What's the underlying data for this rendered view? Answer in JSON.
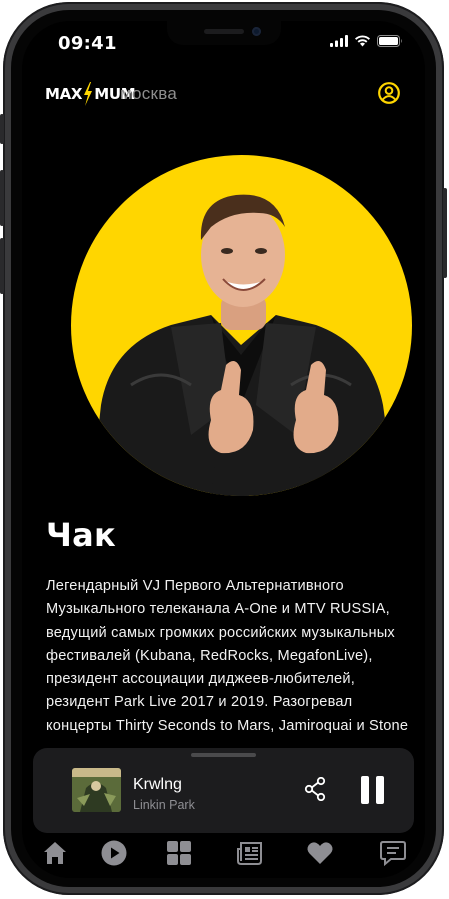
{
  "status_bar": {
    "time": "09:41"
  },
  "header": {
    "logo_left": "MAX",
    "logo_right": "MUM",
    "city": "москва"
  },
  "dj": {
    "name": "Чак",
    "bio": "Легендарный VJ Первого Альтернативного Музыкального телеканала A-One и MTV RUSSIA, ведущий самых громких российских музыкальных фестивалей (Kubana, RedRocks, MegafonLive), президент ассоциации диджеев-любителей, резидент Park Live 2017 и 2019. Разогревал концерты Thirty Seconds to Mars, Jamiroquai и Stone"
  },
  "player": {
    "track": "Krwlng",
    "artist": "Linkin Park"
  },
  "tabs": [
    {
      "icon": "home-icon"
    },
    {
      "icon": "play-icon"
    },
    {
      "icon": "grid-icon"
    },
    {
      "icon": "news-icon"
    },
    {
      "icon": "heart-icon"
    },
    {
      "icon": "chat-icon"
    }
  ],
  "colors": {
    "accent": "#ffd600",
    "background": "#000000",
    "player_bg": "#1c1c1e",
    "tab_icon": "#8e8e93"
  }
}
